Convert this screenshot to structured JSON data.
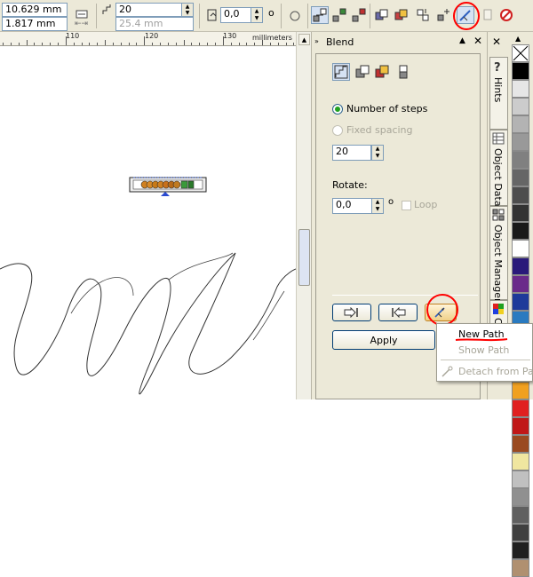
{
  "propbar": {
    "pos_x": "10.629 mm",
    "pos_y": "1.817 mm",
    "steps_value": "20",
    "spacing_value": "25.4 mm",
    "angle_value": "0,0",
    "degree_symbol": "o"
  },
  "ruler": {
    "labels": [
      "110",
      "120",
      "130"
    ],
    "units": "millimeters"
  },
  "docker": {
    "title": "Blend",
    "number_of_steps_label": "Number of steps",
    "fixed_spacing_label": "Fixed spacing",
    "steps_value": "20",
    "rotate_label": "Rotate:",
    "rotate_value": "0,0",
    "degree_symbol": "o",
    "loop_label": "Loop",
    "apply_label": "Apply"
  },
  "tabs": {
    "hints": "Hints",
    "object_data": "Object Data",
    "object_manager": "Object Manager",
    "color": "Color"
  },
  "menu": {
    "new_path": "New Path",
    "show_path": "Show Path",
    "detach_from_path": "Detach from Path"
  },
  "palette_colors": [
    "#ffffff",
    "#000000",
    "#e6e6e6",
    "#cccccc",
    "#b3b3b3",
    "#999999",
    "#808080",
    "#666666",
    "#4d4d4d",
    "#333333",
    "#1a1a1a",
    "#ffffff",
    "#2a1a7a",
    "#6a2a8a",
    "#1e3a9a",
    "#2a7ac0",
    "#2a8a3a",
    "#3aa83a",
    "#e8e020",
    "#f0a020",
    "#e02020",
    "#c01818",
    "#9a4a20",
    "#f0e6a0",
    "#c0c0c0",
    "#909090",
    "#606060",
    "#404040",
    "#202020",
    "#b09070"
  ],
  "accent_annotation": "#ff0000"
}
